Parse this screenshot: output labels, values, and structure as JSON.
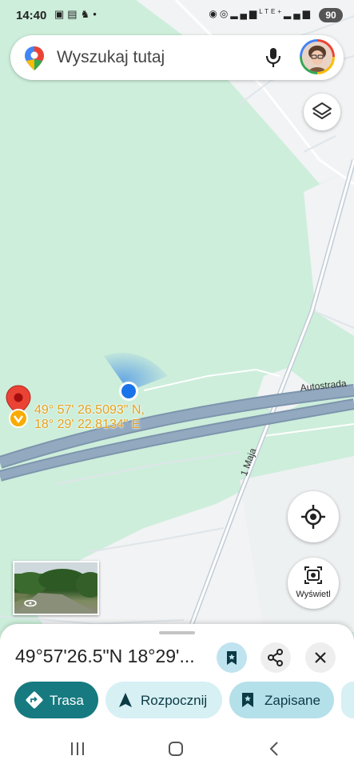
{
  "status_bar": {
    "time": "14:40",
    "left_icons": [
      "screenshot-icon",
      "gallery-icon",
      "horse-icon",
      "dot-icon"
    ],
    "network": "LTE+",
    "battery": "90"
  },
  "search": {
    "placeholder": "Wyszukaj tutaj",
    "icons": [
      "maps-pin-icon",
      "mic-icon",
      "avatar"
    ]
  },
  "map": {
    "coordinates_label": {
      "line1": "49° 57' 26.5093\" N,",
      "line2": "18° 29' 22.8134\" E"
    },
    "road_labels": [
      "Autostrada",
      "1 Maja"
    ],
    "controls": {
      "layers": "layers-icon",
      "locate": "crosshair-icon",
      "lens_label": "Wyświetl"
    },
    "colors": {
      "park": "#cdeedb",
      "highway": "#8aa1b8",
      "road": "#ffffff",
      "my_location": "#1a73e8",
      "pin": "#ea4335",
      "coords_text": "#e3a11b"
    }
  },
  "place_sheet": {
    "title": "49°57'26.5\"N 18°29'...",
    "buttons": [
      "bookmark-icon",
      "share-icon",
      "close-icon"
    ],
    "actions": [
      {
        "label": "Trasa",
        "icon": "directions-icon"
      },
      {
        "label": "Rozpocznij",
        "icon": "navigation-arrow-icon"
      },
      {
        "label": "Zapisane",
        "icon": "bookmark-icon"
      }
    ]
  },
  "nav_bar": [
    "recents-icon",
    "home-icon",
    "back-icon"
  ]
}
